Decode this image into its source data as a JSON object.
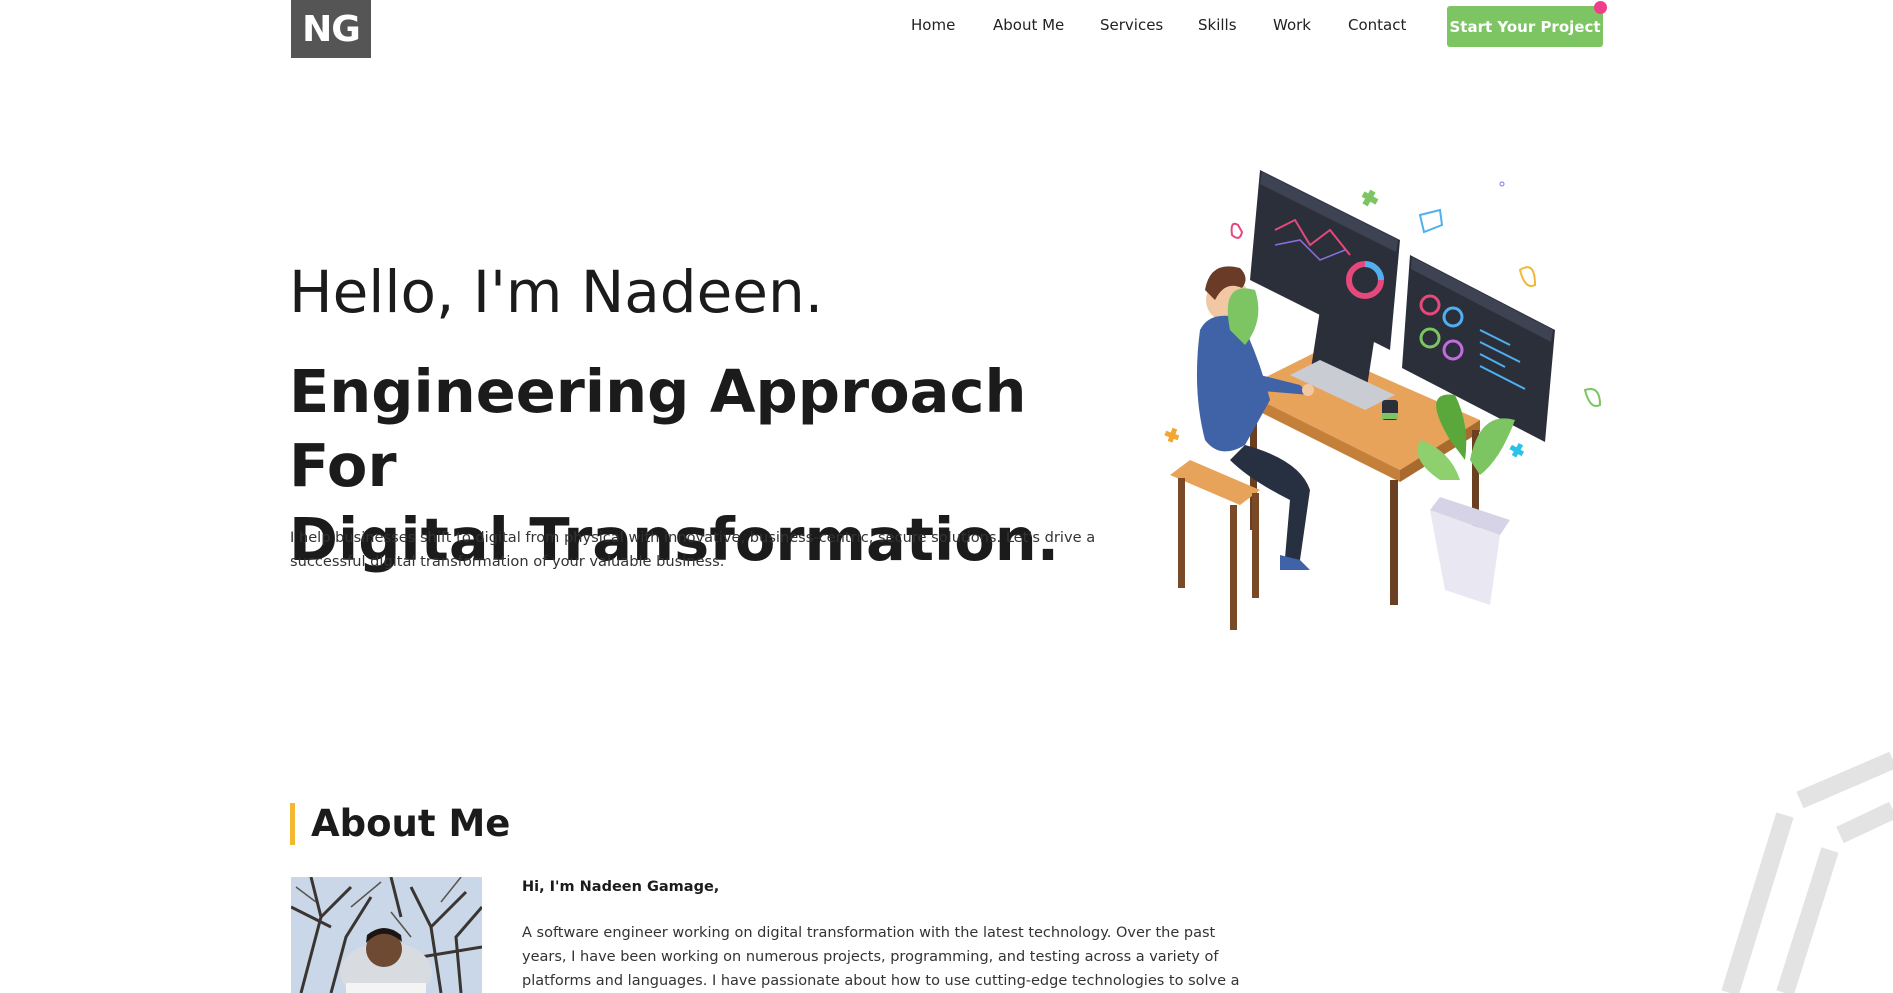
{
  "header": {
    "logo": "NG",
    "nav": [
      "Home",
      "About Me",
      "Services",
      "Skills",
      "Work",
      "Contact"
    ],
    "cta_label": "Start Your Project"
  },
  "hero": {
    "greeting": "Hello, I'm Nadeen.",
    "title_line1": "Engineering Approach For",
    "title_line2": "Digital Transformation.",
    "description": "I help businesses shift to digital from physical with innovative, business-centric, secure solutions. Let's drive a successful digital transformation of your valuable business."
  },
  "about": {
    "title": "About Me",
    "hello": "Hi, I'm Nadeen Gamage,",
    "body": "A software engineer working on digital transformation with the latest technology. Over the past years, I have been working on numerous projects, programming, and testing across a variety of platforms and languages. I have passionate about how to use cutting-edge technologies to solve a vast array of"
  },
  "colors": {
    "accent_green": "#7cc562",
    "accent_yellow": "#f2b733",
    "notification_pink": "#ef3e8a",
    "logo_gray": "#555555"
  }
}
